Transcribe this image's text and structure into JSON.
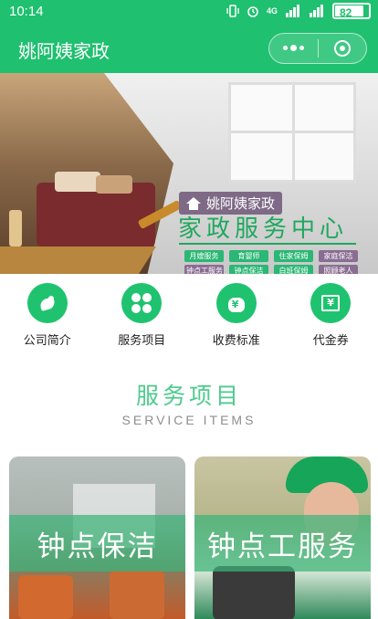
{
  "status_bar": {
    "time": "10:14",
    "network": "4G",
    "battery": "82",
    "battery_level": 0.82
  },
  "nav": {
    "title": "姚阿姨家政"
  },
  "banner": {
    "brand": "姚阿姨家政",
    "headline": "家政服务中心",
    "tags": [
      {
        "text": "月嫂服务",
        "color": "g"
      },
      {
        "text": "育婴师",
        "color": "g"
      },
      {
        "text": "住家保姆",
        "color": "g"
      },
      {
        "text": "家庭保洁",
        "color": "p"
      },
      {
        "text": "钟点工服务",
        "color": "p"
      },
      {
        "text": "钟点保洁",
        "color": "g"
      },
      {
        "text": "白班保姆",
        "color": "g"
      },
      {
        "text": "照顾老人",
        "color": "p"
      }
    ]
  },
  "menu": [
    {
      "label": "公司简介",
      "icon": "company-icon"
    },
    {
      "label": "服务项目",
      "icon": "services-icon"
    },
    {
      "label": "收费标准",
      "icon": "fee-icon"
    },
    {
      "label": "代金券",
      "icon": "voucher-icon"
    }
  ],
  "section": {
    "title": "服务项目",
    "subtitle": "SERVICE ITEMS"
  },
  "cards": [
    {
      "label": "钟点保洁"
    },
    {
      "label": "钟点工服务"
    }
  ],
  "colors": {
    "brand_green": "#1fc06f",
    "title_green": "#4dcb8d"
  }
}
